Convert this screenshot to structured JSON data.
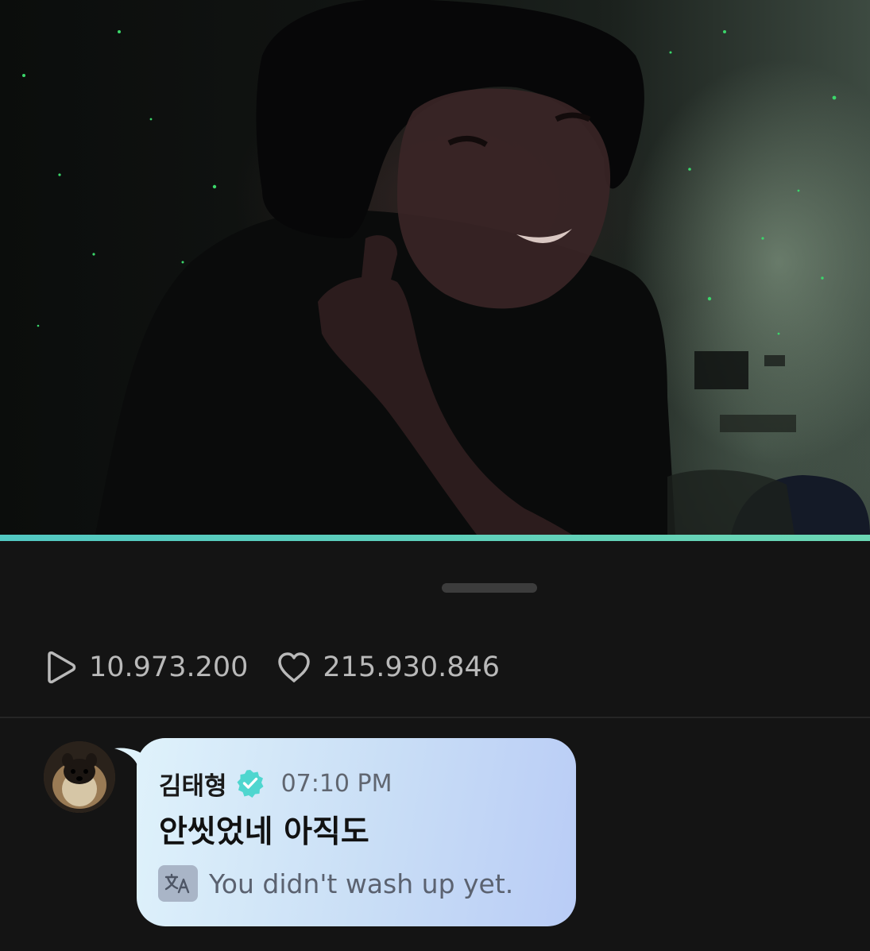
{
  "video": {
    "progress": 1.0,
    "accent_color": "#5fd0bd"
  },
  "stats": {
    "plays": "10.973.200",
    "plays_icon": "play-outline-icon",
    "likes": "215.930.846",
    "likes_icon": "heart-outline-icon"
  },
  "comment": {
    "author": "김태형",
    "verified_icon": "verified-badge-icon",
    "verified_color": "#4fd6cf",
    "time": "07:10 PM",
    "message": "안씻었네 아직도",
    "translate_icon": "translate-icon",
    "translation": "You didn't wash up yet.",
    "bubble_colors": [
      "#dff2fb",
      "#b9ccf6"
    ]
  }
}
